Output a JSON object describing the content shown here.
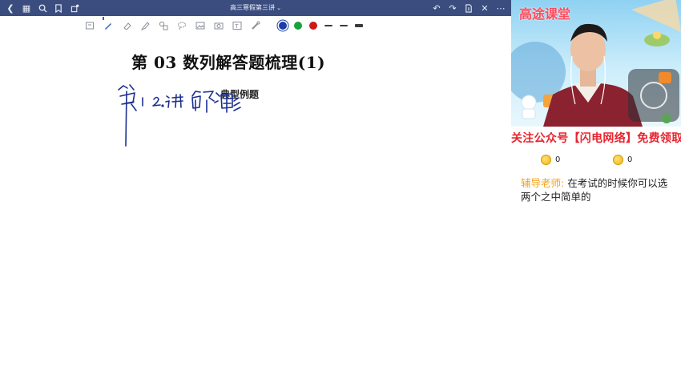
{
  "window": {
    "title": "高三寒假第三讲"
  },
  "topbar_icons": {
    "left": [
      "back-icon",
      "grid-icon",
      "search-icon",
      "bookmark-icon",
      "share-icon"
    ],
    "right": [
      "undo-icon",
      "redo-icon",
      "export-icon",
      "close-icon",
      "more-icon"
    ]
  },
  "toolbar": {
    "tools": [
      "text-select-tool",
      "pen-tool",
      "eraser-tool",
      "marker-tool",
      "shapes-tool",
      "lasso-tool",
      "image-tool",
      "camera-tool",
      "textbox-tool",
      "laser-tool"
    ],
    "colors": [
      "#1d3ea7",
      "#19a23c",
      "#d01818"
    ],
    "selected_color": "#1d3ea7"
  },
  "canvas": {
    "lesson_title": "第 03 数列解答题梳理(1)",
    "section_label": "典型例题",
    "handwriting_alt": "第1 2.讲 解析"
  },
  "panel": {
    "brand": "高途课堂",
    "promo": "关注公众号【闪电网络】免费领取",
    "likes": [
      "0",
      "0"
    ],
    "chat": {
      "speaker": "辅导老师:",
      "message": "在考试的时候你可以选两个之中简单的"
    }
  }
}
